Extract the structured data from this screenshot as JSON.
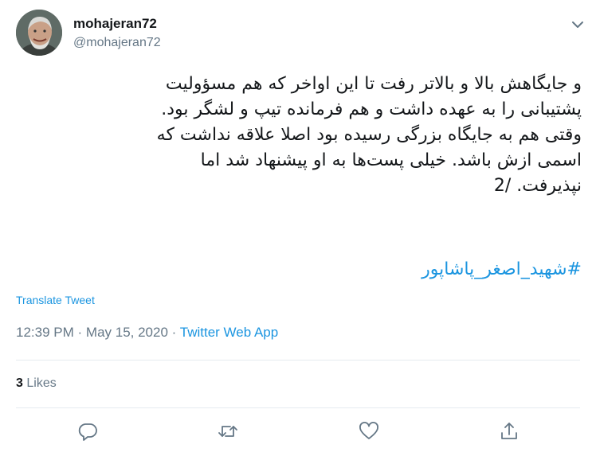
{
  "author": {
    "name": "mohajeran72",
    "handle": "@mohajeran72"
  },
  "tweet": {
    "text": "و جایگاهش بالا و بالاتر رفت تا این اواخر که هم مسؤولیت\nپشتیبانی را به عهده داشت و هم فرمانده تیپ و لشگر بود.\nوقتی هم به جایگاه بزرگی رسیده بود اصلا علاقه نداشت که\nاسمی ازش باشد. خیلی پست‌ها به او پیشنهاد شد اما\nنپذیرفت. /2",
    "hashtag": "#شهید_اصغر_پاشاپور",
    "translate_label": "Translate Tweet"
  },
  "meta": {
    "time": "12:39 PM",
    "separator1": "·",
    "date": "May 15, 2020",
    "separator2": "·",
    "app": "Twitter Web App"
  },
  "stats": {
    "likes_count": "3",
    "likes_label": "Likes"
  },
  "icons": {
    "more": "chevron-down-icon",
    "reply": "reply-icon",
    "retweet": "retweet-icon",
    "like": "heart-icon",
    "share": "share-icon"
  },
  "colors": {
    "link": "#1b95e0",
    "secondary": "#657786",
    "divider": "#e6ecf0"
  }
}
